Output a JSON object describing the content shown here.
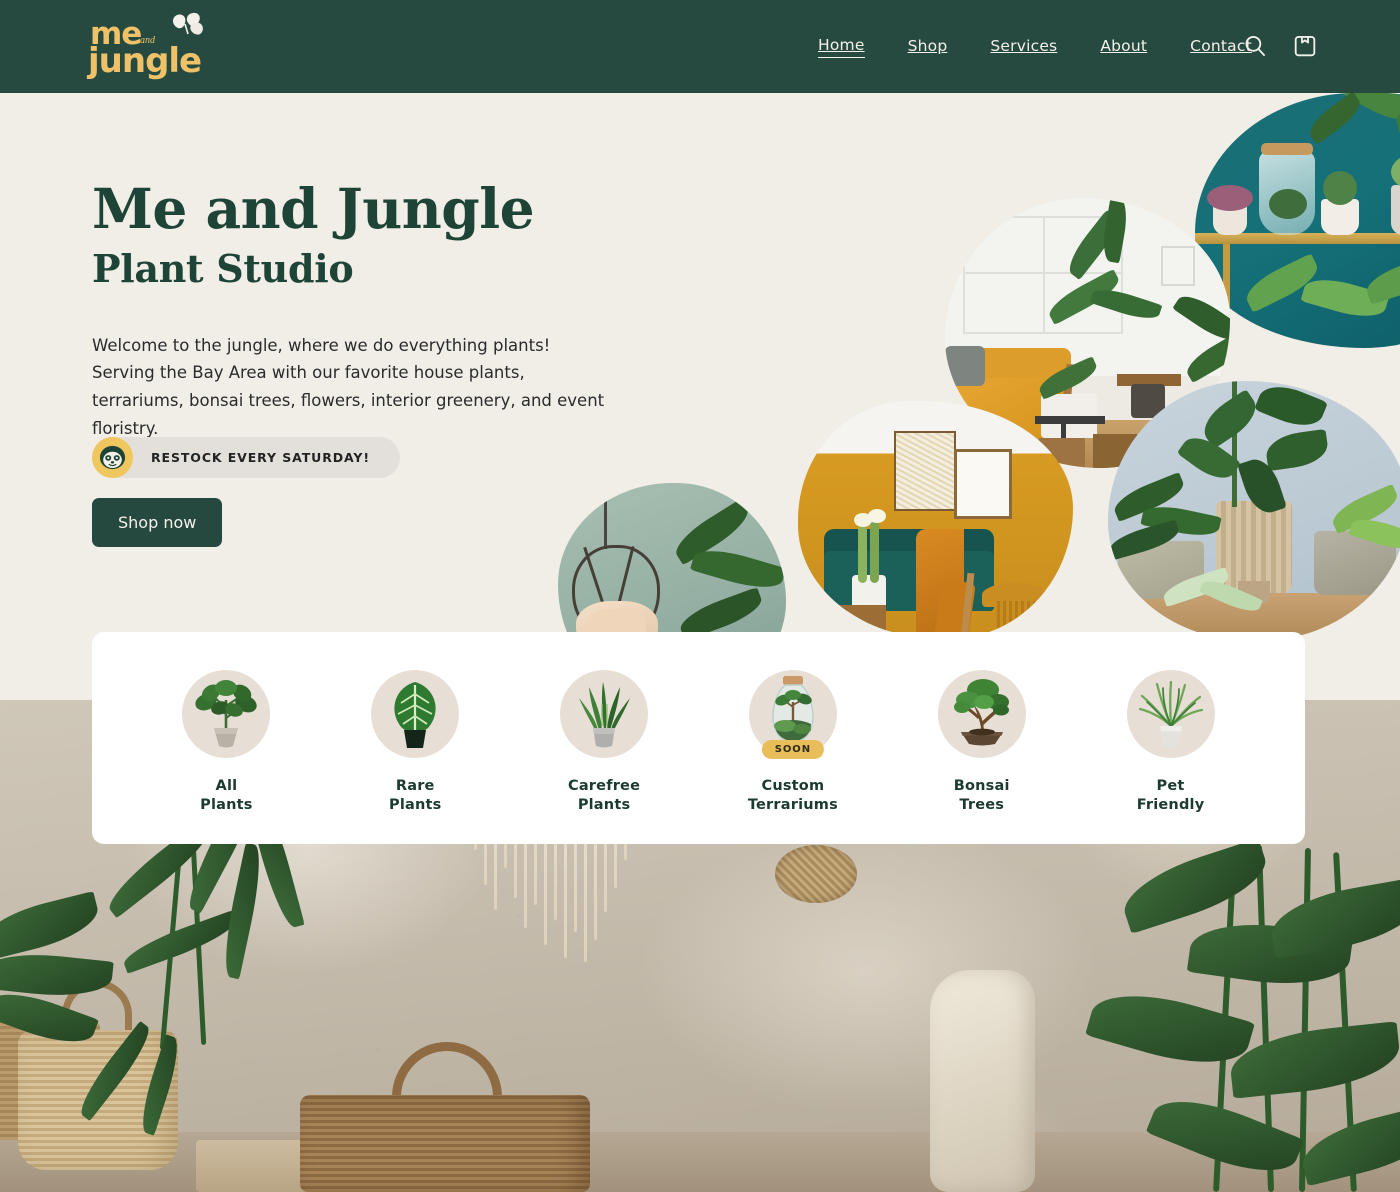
{
  "header": {
    "logo": {
      "line1": "me",
      "small": "and",
      "line2": "jungle",
      "icon": "leaves-icon"
    },
    "nav": [
      {
        "label": "Home",
        "active": true
      },
      {
        "label": "Shop",
        "active": false
      },
      {
        "label": "Services",
        "active": false
      },
      {
        "label": "About",
        "active": false
      },
      {
        "label": "Contact",
        "active": false
      }
    ],
    "search_icon": "search-icon",
    "cart_icon": "shopping-bag-icon",
    "background_color": "#264A40"
  },
  "hero": {
    "title": "Me and Jungle",
    "subtitle": "Plant Studio",
    "paragraph": "Welcome to the jungle, where we do everything plants! Serving the Bay Area with our favorite house plants, terrariums, bonsai trees, flowers, interior greenery, and event floristry.",
    "restock_badge": {
      "icon": "sloth-icon",
      "label": "RESTOCK EVERY SATURDAY!"
    },
    "cta": "Shop now",
    "text_color": "#1E4437",
    "page_background": "#F1EDE7"
  },
  "categories": [
    {
      "label_line1": "All",
      "label_line2": "Plants",
      "icon": "monstera-plant-icon",
      "badge": ""
    },
    {
      "label_line1": "Rare",
      "label_line2": "Plants",
      "icon": "anthurium-leaf-icon",
      "badge": ""
    },
    {
      "label_line1": "Carefree",
      "label_line2": "Plants",
      "icon": "snake-plant-icon",
      "badge": ""
    },
    {
      "label_line1": "Custom",
      "label_line2": "Terrariums",
      "icon": "terrarium-jar-icon",
      "badge": "SOON"
    },
    {
      "label_line1": "Bonsai",
      "label_line2": "Trees",
      "icon": "bonsai-tree-icon",
      "badge": ""
    },
    {
      "label_line1": "Pet",
      "label_line2": "Friendly",
      "icon": "spider-plant-icon",
      "badge": ""
    }
  ],
  "colors": {
    "brand_green": "#264A40",
    "brand_gold": "#EFC169",
    "cream": "#F1EDE7",
    "badge_gold": "#E9BD5A",
    "card_white": "#FFFFFF"
  }
}
